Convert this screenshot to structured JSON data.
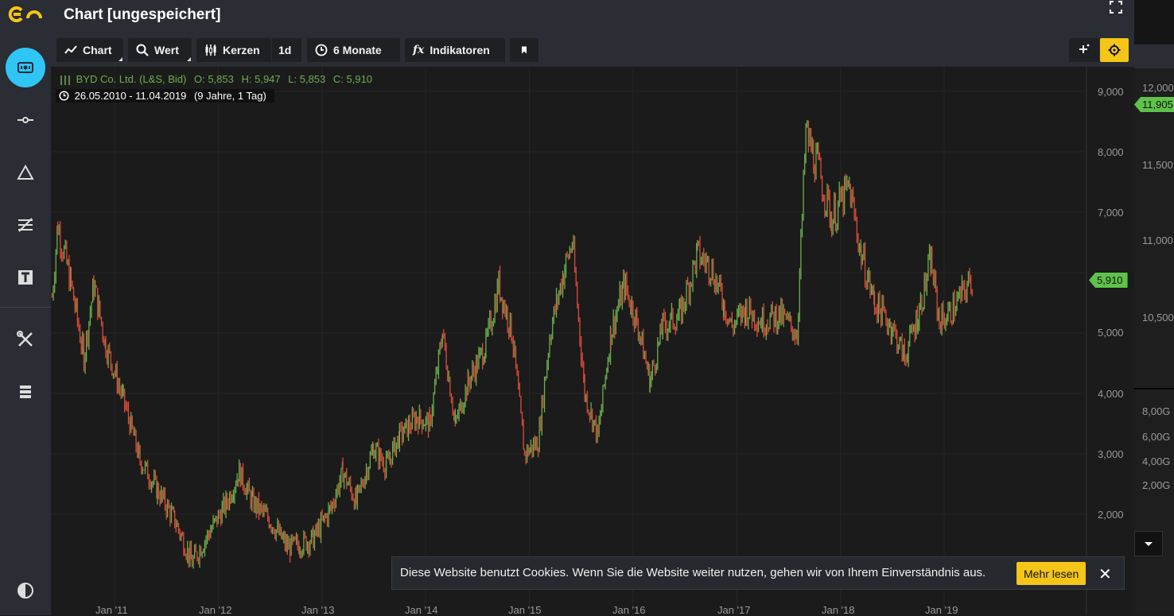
{
  "header": {
    "title": "Chart [ungespeichert]"
  },
  "toolbar": {
    "chart_label": "Chart",
    "wert_label": "Wert",
    "kerzen_label": "Kerzen",
    "interval_label": "1d",
    "range_label": "6 Monate",
    "indicators_label": "Indikatoren"
  },
  "legend": {
    "instrument": "BYD Co. Ltd. (L&S, Bid)",
    "open": "O: 5,853",
    "high": "H: 5,947",
    "low": "L: 5,853",
    "close": "C: 5,910",
    "daterange": "26.05.2010 - 11.04.2019",
    "duration": "(9 Jahre, 1 Tag)"
  },
  "price_axis": [
    "9,000",
    "8,000",
    "7,000",
    "5,000",
    "4,000",
    "3,000",
    "2,000"
  ],
  "current_price": "5,910",
  "right_axis": [
    "12,000",
    "11,500",
    "11,000",
    "10,500",
    "8,00G",
    "6,00G",
    "4,00G",
    "2,00G"
  ],
  "right_tag": "11,905",
  "time_axis": [
    "Jan '11",
    "Jan '12",
    "Jan '13",
    "Jan '14",
    "Jan '15",
    "Jan '16",
    "Jan '17",
    "Jan '18",
    "Jan '19"
  ],
  "cookie": {
    "text": "Diese Website benutzt Cookies. Wenn Sie die Website weiter nutzen, gehen wir von Ihrem Einverständnis aus.",
    "button": "Mehr lesen",
    "close": "✕"
  },
  "colors": {
    "up": "#6ab04c",
    "down": "#e04b3a",
    "accent": "#f5c518",
    "active": "#2fc6f6"
  },
  "chart_data": {
    "type": "line",
    "series": [
      {
        "values": [
          [
            "2010-05-26",
            5.6
          ],
          [
            "2010-06-15",
            6.8
          ],
          [
            "2010-08-01",
            5.8
          ],
          [
            "2010-09-15",
            4.6
          ],
          [
            "2010-10-20",
            5.8
          ],
          [
            "2010-12-01",
            4.8
          ],
          [
            "2011-02-01",
            3.9
          ],
          [
            "2011-04-01",
            2.9
          ],
          [
            "2011-06-01",
            2.4
          ],
          [
            "2011-08-01",
            1.9
          ],
          [
            "2011-10-01",
            1.2
          ],
          [
            "2011-12-01",
            1.7
          ],
          [
            "2012-02-01",
            2.2
          ],
          [
            "2012-03-15",
            2.7
          ],
          [
            "2012-05-01",
            2.2
          ],
          [
            "2012-07-01",
            1.9
          ],
          [
            "2012-09-01",
            1.45
          ],
          [
            "2012-10-15",
            1.5
          ],
          [
            "2012-12-01",
            1.6
          ],
          [
            "2013-02-01",
            2.1
          ],
          [
            "2013-03-15",
            2.7
          ],
          [
            "2013-05-01",
            2.2
          ],
          [
            "2013-07-01",
            3.1
          ],
          [
            "2013-08-15",
            2.8
          ],
          [
            "2013-10-01",
            3.3
          ],
          [
            "2013-12-01",
            3.6
          ],
          [
            "2014-01-15",
            3.5
          ],
          [
            "2014-03-01",
            5.0
          ],
          [
            "2014-04-15",
            3.5
          ],
          [
            "2014-06-01",
            4.2
          ],
          [
            "2014-08-01",
            4.8
          ],
          [
            "2014-09-15",
            5.8
          ],
          [
            "2014-11-01",
            5.0
          ],
          [
            "2014-12-15",
            3.0
          ],
          [
            "2015-02-01",
            3.2
          ],
          [
            "2015-03-15",
            5.0
          ],
          [
            "2015-05-01",
            6.0
          ],
          [
            "2015-06-01",
            6.5
          ],
          [
            "2015-07-15",
            4.0
          ],
          [
            "2015-08-30",
            3.3
          ],
          [
            "2015-10-15",
            5.0
          ],
          [
            "2015-12-01",
            5.8
          ],
          [
            "2016-01-15",
            5.2
          ],
          [
            "2016-03-01",
            4.2
          ],
          [
            "2016-04-15",
            5.1
          ],
          [
            "2016-06-15",
            5.3
          ],
          [
            "2016-08-15",
            6.3
          ],
          [
            "2016-10-01",
            6.1
          ],
          [
            "2016-11-15",
            5.5
          ],
          [
            "2016-12-15",
            5.1
          ],
          [
            "2017-02-01",
            5.4
          ],
          [
            "2017-04-01",
            5.2
          ],
          [
            "2017-06-01",
            5.3
          ],
          [
            "2017-08-01",
            5.0
          ],
          [
            "2017-09-01",
            8.3
          ],
          [
            "2017-10-15",
            7.7
          ],
          [
            "2017-12-01",
            6.9
          ],
          [
            "2018-02-01",
            7.4
          ],
          [
            "2018-03-15",
            6.3
          ],
          [
            "2018-05-01",
            5.5
          ],
          [
            "2018-07-01",
            5.1
          ],
          [
            "2018-08-15",
            4.6
          ],
          [
            "2018-10-01",
            5.3
          ],
          [
            "2018-11-15",
            6.2
          ],
          [
            "2018-12-15",
            5.2
          ],
          [
            "2019-01-15",
            5.3
          ],
          [
            "2019-02-15",
            5.5
          ],
          [
            "2019-04-11",
            5.91
          ]
        ]
      }
    ],
    "ylim": [
      1.0,
      9.4
    ],
    "grid": true
  }
}
